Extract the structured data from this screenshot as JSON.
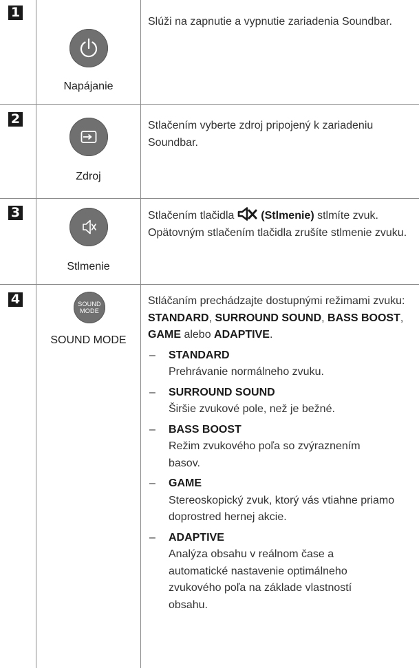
{
  "rows": [
    {
      "number": "1",
      "icon": "power-icon",
      "label": "Napájanie",
      "description": "Slúži na zapnutie a vypnutie zariadenia Soundbar."
    },
    {
      "number": "2",
      "icon": "source-icon",
      "label": "Zdroj",
      "description": "Stlačením vyberte zdroj pripojený k zariadeniu Soundbar."
    },
    {
      "number": "3",
      "icon": "mute-icon",
      "label": "Stlmenie",
      "description_before": "Stlačením tlačidla",
      "description_term": "(Stlmenie)",
      "description_after": "stlmíte zvuk. Opätovným stlačením tlačidla zrušíte stlmenie zvuku."
    },
    {
      "number": "4",
      "icon": "sound-mode-button",
      "button_text_line1": "SOUND",
      "button_text_line2": "MODE",
      "label": "SOUND MODE",
      "intro_before": "Stláčaním prechádzajte dostupnými režimami zvuku:",
      "intro_modes": [
        "STANDARD",
        "SURROUND SOUND",
        "BASS BOOST",
        "GAME",
        "ADAPTIVE"
      ],
      "intro_sep": ", ",
      "intro_or": " alebo ",
      "intro_end": ".",
      "modes": [
        {
          "name": "STANDARD",
          "desc": "Prehrávanie normálneho zvuku."
        },
        {
          "name": "SURROUND SOUND",
          "desc": "Širšie zvukové pole, než je bežné."
        },
        {
          "name": "BASS BOOST",
          "desc": "Režim zvukového poľa so zvýraznením basov."
        },
        {
          "name": "GAME",
          "desc": "Stereoskopický zvuk, ktorý vás vtiahne priamo doprostred hernej akcie."
        },
        {
          "name": "ADAPTIVE",
          "desc": "Analýza obsahu v reálnom čase a automatické nastavenie optimálneho zvukového poľa na základe vlastností obsahu."
        }
      ],
      "dash": "–"
    }
  ],
  "colors": {
    "button_fill": "#707070",
    "number_badge": "#1a1a1a",
    "rule": "#8c8c8c"
  }
}
